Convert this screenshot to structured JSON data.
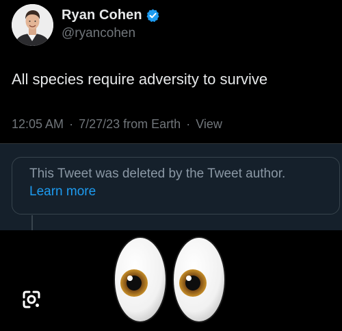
{
  "author": {
    "display_name": "Ryan Cohen",
    "handle": "@ryancohen",
    "verified": true,
    "verified_icon": "verified-badge-icon",
    "avatar_icon": "profile-avatar"
  },
  "tweet": {
    "text": "All species require adversity to survive",
    "time": "12:05 AM",
    "date": "7/27/23",
    "source": "from Earth",
    "view_link": "View",
    "separator": "·"
  },
  "quoted": {
    "deleted_text": "This Tweet was deleted by the Tweet author.",
    "learn_more": "Learn more"
  },
  "overlay": {
    "lens_icon": "google-lens-icon",
    "emoji_icon": "eyes-emoji"
  },
  "colors": {
    "background": "#000000",
    "text_primary": "#e7e9ea",
    "text_secondary": "#71767b",
    "quote_bg": "#15202b",
    "link": "#1d9bf0",
    "verified": "#1d9bf0"
  }
}
